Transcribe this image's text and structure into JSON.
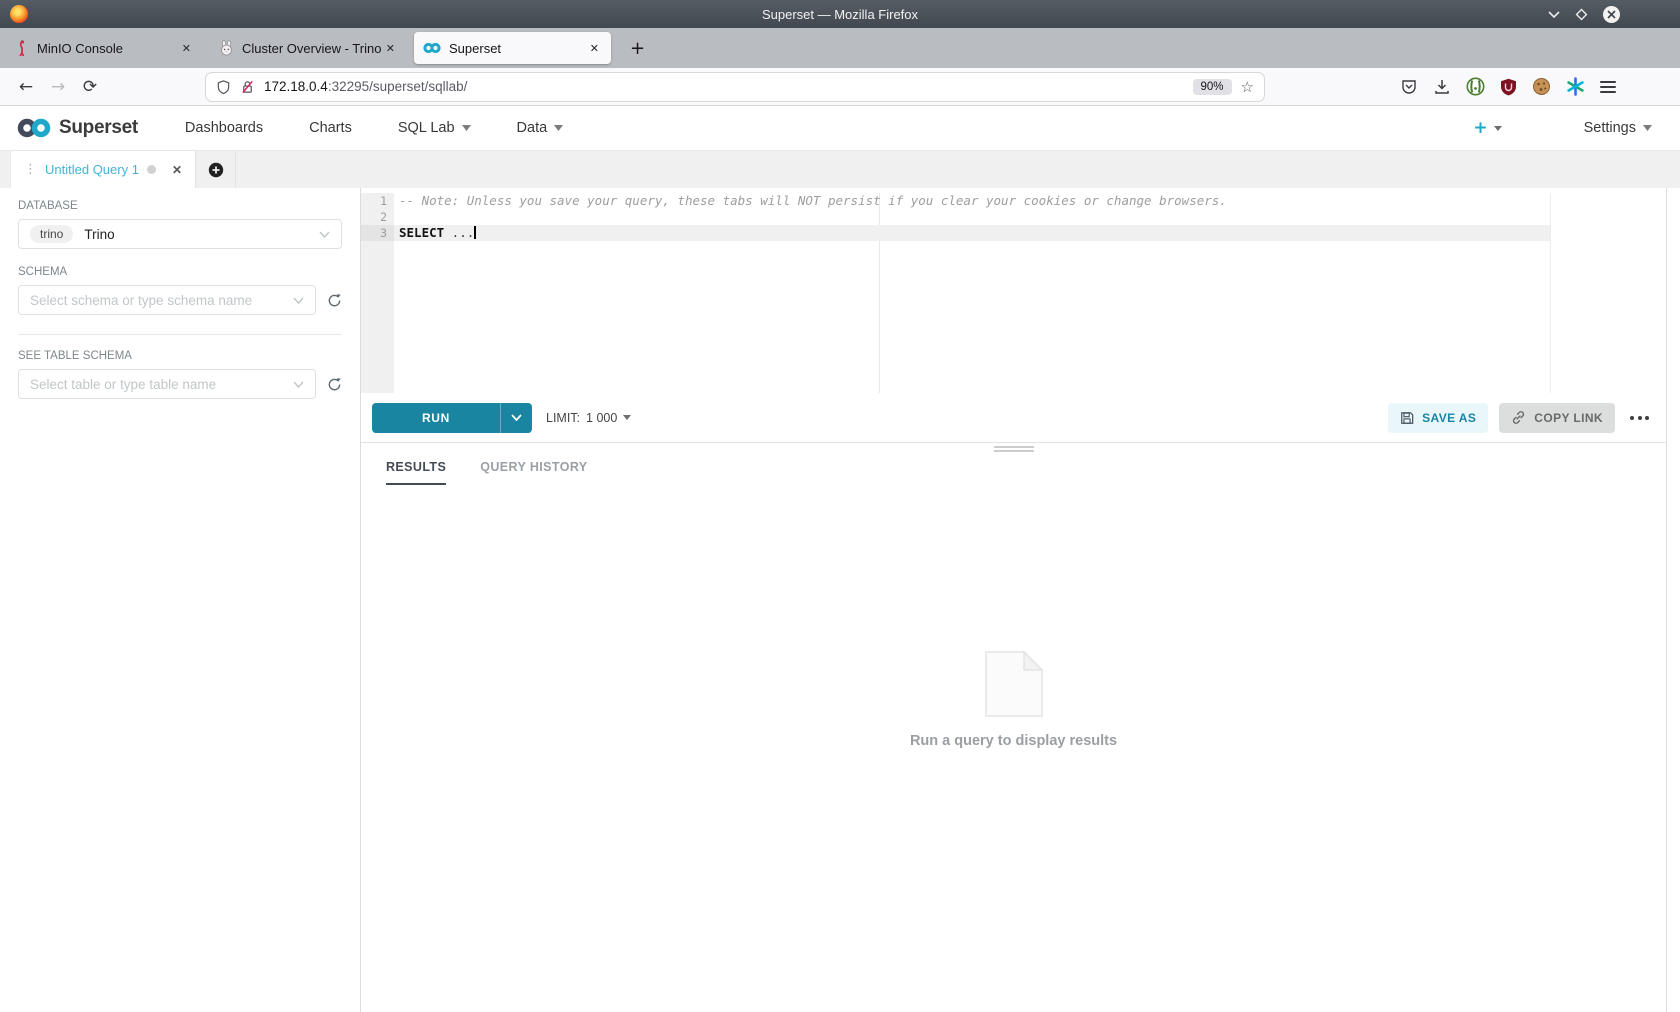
{
  "window": {
    "title": "Superset — Mozilla Firefox"
  },
  "browser_tabs": [
    {
      "title": "MinIO Console"
    },
    {
      "title": "Cluster Overview - Trino"
    },
    {
      "title": "Superset"
    }
  ],
  "urlbar": {
    "host": "172.18.0.4",
    "path": ":32295/superset/sqllab/",
    "zoom_badge": "90%"
  },
  "nav": {
    "brand": "Superset",
    "items": [
      {
        "label": "Dashboards"
      },
      {
        "label": "Charts"
      },
      {
        "label": "SQL Lab"
      },
      {
        "label": "Data"
      }
    ],
    "settings_label": "Settings"
  },
  "query_tabs": {
    "active_label": "Untitled Query 1"
  },
  "sidebar": {
    "database_label": "DATABASE",
    "database_badge": "trino",
    "database_value": "Trino",
    "schema_label": "SCHEMA",
    "schema_placeholder": "Select schema or type schema name",
    "table_label": "SEE TABLE SCHEMA",
    "table_placeholder": "Select table or type table name"
  },
  "editor": {
    "lines": [
      {
        "num": "1",
        "text": "-- Note: Unless you save your query, these tabs will NOT persist if you clear your cookies or change browsers."
      },
      {
        "num": "2",
        "text": ""
      },
      {
        "num": "3",
        "keyword": "SELECT",
        "rest": " ..."
      }
    ]
  },
  "run_toolbar": {
    "run_label": "RUN",
    "limit_label": "LIMIT:",
    "limit_value": "1 000",
    "save_as_label": "SAVE AS",
    "copy_link_label": "COPY LINK"
  },
  "results": {
    "tab_results": "RESULTS",
    "tab_history": "QUERY HISTORY",
    "empty_message": "Run a query to display results"
  },
  "colors": {
    "accent": "#20a7c9",
    "run_button": "#1985a0",
    "query_tab_label": "#45b2d6",
    "minio_red": "#c72e49"
  }
}
